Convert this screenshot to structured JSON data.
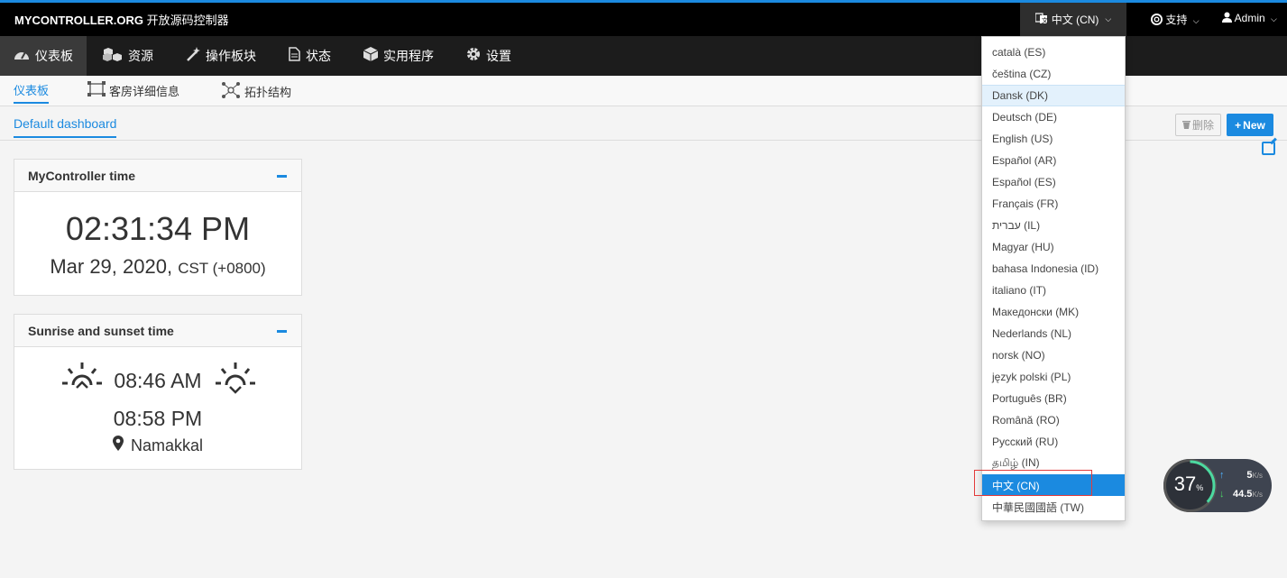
{
  "topbar": {
    "brand": "MYCONTROLLER.ORG",
    "brand_cn": "开放源码控制器",
    "language": "中文 (CN)",
    "support": "支持",
    "user": "Admin"
  },
  "mainnav": {
    "items": [
      {
        "label": "仪表板",
        "icon": "dashboard-icon"
      },
      {
        "label": "资源",
        "icon": "resources-icon"
      },
      {
        "label": "操作板块",
        "icon": "wand-icon"
      },
      {
        "label": "状态",
        "icon": "document-icon"
      },
      {
        "label": "实用程序",
        "icon": "cube-icon"
      },
      {
        "label": "设置",
        "icon": "gear-icon"
      }
    ]
  },
  "subnav": {
    "items": [
      {
        "label": "仪表板"
      },
      {
        "label": "客房详细信息",
        "icon": "room-icon"
      },
      {
        "label": "拓扑结构",
        "icon": "topology-icon"
      }
    ]
  },
  "dashboard": {
    "tab": "Default dashboard",
    "delete_label": "删除",
    "new_label": "New"
  },
  "time_panel": {
    "title": "MyController time",
    "time": "02:31:34 PM",
    "date": "Mar 29, 2020,",
    "tz": "CST (+0800)"
  },
  "sun_panel": {
    "title": "Sunrise and sunset time",
    "sunrise": "08:46 AM",
    "sunset": "08:58 PM",
    "location": "Namakkal"
  },
  "language_menu": {
    "items": [
      "català (ES)",
      "čeština (CZ)",
      "Dansk (DK)",
      "Deutsch (DE)",
      "English (US)",
      "Español (AR)",
      "Español (ES)",
      "Français (FR)",
      "עברית (IL)",
      "Magyar (HU)",
      "bahasa Indonesia (ID)",
      "italiano (IT)",
      "Македонски (MK)",
      "Nederlands (NL)",
      "norsk (NO)",
      "język polski (PL)",
      "Português (BR)",
      "Română (RO)",
      "Русский (RU)",
      "தமிழ் (IN)",
      "中文 (CN)",
      "中華民國國語 (TW)"
    ],
    "hovered": "Dansk (DK)",
    "selected": "中文 (CN)"
  },
  "speed_widget": {
    "percent": "37",
    "percent_symbol": "%",
    "upload": "5",
    "download": "44.5",
    "unit": "K/s"
  },
  "colors": {
    "accent": "#1b8ae0",
    "topbar": "#000000",
    "nav": "#1c1c1c"
  }
}
